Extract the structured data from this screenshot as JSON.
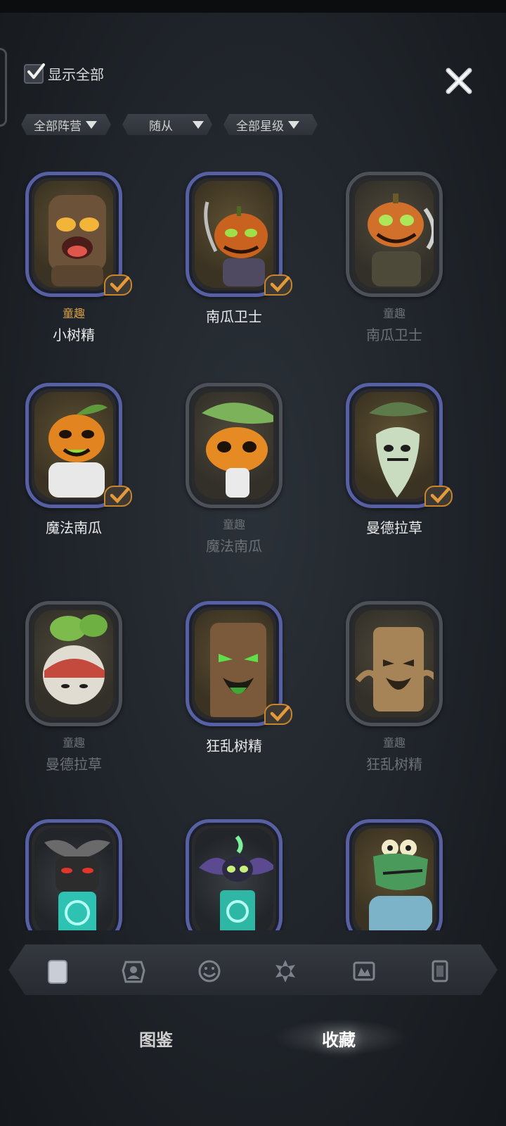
{
  "header": {
    "show_all_label": "显示全部",
    "show_all_checked": true
  },
  "filters": [
    {
      "label": "全部阵营"
    },
    {
      "label": "随从"
    },
    {
      "label": "全部星级"
    }
  ],
  "cards": [
    {
      "tag": "童趣",
      "name": "小树精",
      "owned": true,
      "style": "gold",
      "icon": "treant-icon"
    },
    {
      "tag": "",
      "name": "南瓜卫士",
      "owned": true,
      "style": "normal",
      "icon": "pumpkin-guard-icon"
    },
    {
      "tag": "童趣",
      "name": "南瓜卫士",
      "owned": false,
      "style": "dim",
      "icon": "pumpkin-guard-skin-icon"
    },
    {
      "tag": "",
      "name": "魔法南瓜",
      "owned": true,
      "style": "normal",
      "icon": "magic-pumpkin-icon"
    },
    {
      "tag": "童趣",
      "name": "魔法南瓜",
      "owned": false,
      "style": "dim",
      "icon": "magic-pumpkin-skin-icon"
    },
    {
      "tag": "",
      "name": "曼德拉草",
      "owned": true,
      "style": "normal",
      "icon": "mandrake-icon"
    },
    {
      "tag": "童趣",
      "name": "曼德拉草",
      "owned": false,
      "style": "dim",
      "icon": "mandrake-skin-icon"
    },
    {
      "tag": "",
      "name": "狂乱树精",
      "owned": true,
      "style": "normal",
      "icon": "frenzied-treant-icon"
    },
    {
      "tag": "童趣",
      "name": "狂乱树精",
      "owned": false,
      "style": "dim",
      "icon": "frenzied-treant-skin-icon"
    },
    {
      "tag": "",
      "name": "",
      "owned": true,
      "style": "normal",
      "icon": "demon-icon"
    },
    {
      "tag": "",
      "name": "",
      "owned": true,
      "style": "normal",
      "icon": "winged-imp-icon"
    },
    {
      "tag": "",
      "name": "",
      "owned": true,
      "style": "normal",
      "icon": "crocodile-icon"
    }
  ],
  "category_tabs": [
    {
      "icon": "card-icon",
      "active": true
    },
    {
      "icon": "portrait-icon",
      "active": false
    },
    {
      "icon": "emote-icon",
      "active": false
    },
    {
      "icon": "sun-badge-icon",
      "active": false
    },
    {
      "icon": "board-icon",
      "active": false
    },
    {
      "icon": "card-back-icon",
      "active": false
    }
  ],
  "bottom_tabs": {
    "codex": "图鉴",
    "collection": "收藏",
    "active": "collection"
  },
  "colors": {
    "owned_frame": "#5860a4",
    "unowned_frame": "#4d5157",
    "gold_tag": "#d7a047",
    "check_orange": "#e39a3a"
  }
}
